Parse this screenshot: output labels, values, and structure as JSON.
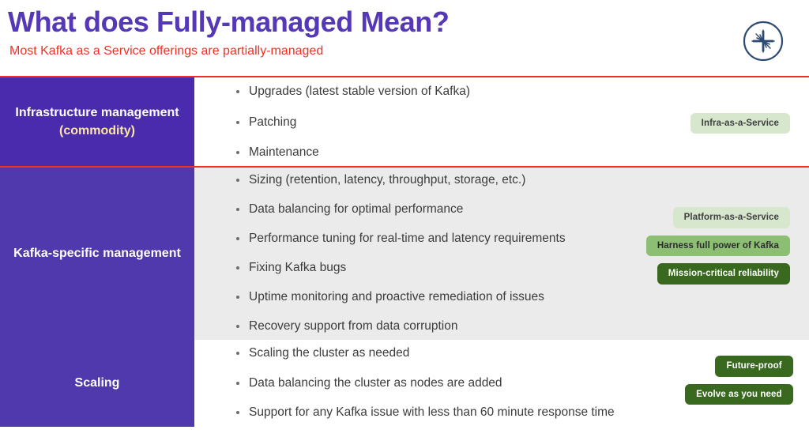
{
  "header": {
    "title": "What does Fully-managed Mean?",
    "subtitle": "Most Kafka as a Service offerings are partially-managed",
    "logo_icon": "starburst-circle-logo",
    "title_color": "#5438b5",
    "subtitle_color": "#ee3124"
  },
  "colors": {
    "category_purple": "#5038ad",
    "category_purple_top": "#4a2bae",
    "accent_red": "#ee3124",
    "row_gray": "#ebebeb",
    "badge_light_green": "#d6e7cd",
    "badge_mid_green": "#8cbf73",
    "badge_dark_green": "#38691f",
    "highlight_yellow": "#fbe6a2"
  },
  "rows": [
    {
      "id": "infrastructure-management",
      "category": "Infrastructure management",
      "category_sub": "(commodity)",
      "highlighted": true,
      "bullets": [
        "Upgrades (latest stable version of Kafka)",
        "Patching",
        "Maintenance"
      ],
      "badges": [
        {
          "label": "Infra-as-a-Service",
          "tone": "tone-light"
        }
      ]
    },
    {
      "id": "kafka-specific-management",
      "category": "Kafka-specific management",
      "category_sub": "",
      "highlighted": false,
      "bullets": [
        "Sizing (retention, latency, throughput, storage, etc.)",
        "Data balancing for optimal performance",
        "Performance tuning for real-time and latency requirements",
        "Fixing Kafka bugs",
        "Uptime monitoring and proactive remediation of issues",
        "Recovery support from data corruption"
      ],
      "badges": [
        {
          "label": "Platform-as-a-Service",
          "tone": "tone-light"
        },
        {
          "label": "Harness full power of Kafka",
          "tone": "tone-mid"
        },
        {
          "label": "Mission-critical reliability",
          "tone": "tone-dark"
        }
      ]
    },
    {
      "id": "scaling",
      "category": "Scaling",
      "category_sub": "",
      "highlighted": false,
      "bullets": [
        "Scaling the cluster as needed",
        "Data balancing the cluster as nodes are added",
        "Support for any Kafka issue with less than 60 minute response time"
      ],
      "badges": [
        {
          "label": "Future-proof",
          "tone": "tone-dark"
        },
        {
          "label": "Evolve as you need",
          "tone": "tone-dark"
        }
      ]
    }
  ]
}
